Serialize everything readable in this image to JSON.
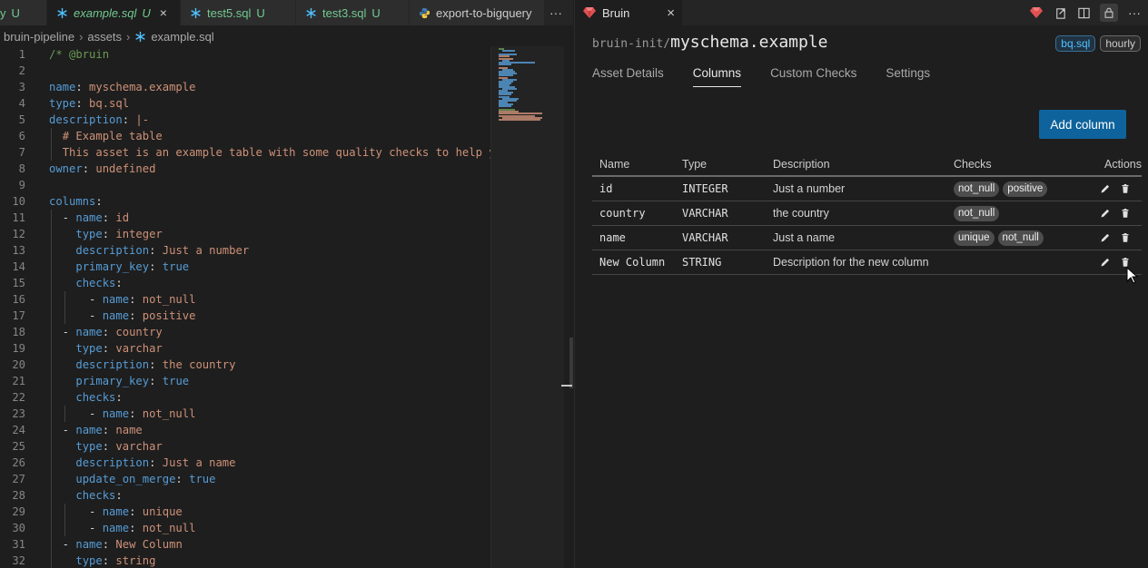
{
  "editor": {
    "tabs": [
      {
        "label": "y",
        "status": "U",
        "icon": "sql-icon"
      },
      {
        "label": "example.sql",
        "status": "U",
        "icon": "sql-icon",
        "active": true
      },
      {
        "label": "test5.sql",
        "status": "U",
        "icon": "sql-icon"
      },
      {
        "label": "test3.sql",
        "status": "U",
        "icon": "sql-icon"
      },
      {
        "label": "export-to-bigquery",
        "status": "",
        "icon": "python-icon"
      }
    ],
    "more": "···",
    "breadcrumb": [
      "bruin-pipeline",
      "assets",
      "example.sql"
    ],
    "line_numbers": [
      "1",
      "2",
      "3",
      "4",
      "5",
      "6",
      "7",
      "8",
      "9",
      "10",
      "11",
      "12",
      "13",
      "14",
      "15",
      "16",
      "17",
      "18",
      "19",
      "20",
      "21",
      "22",
      "23",
      "24",
      "25",
      "26",
      "27",
      "28",
      "29",
      "30",
      "31",
      "32"
    ],
    "code": {
      "l1": "/* @bruin",
      "l3k": "name",
      "l3v": "myschema.example",
      "l4k": "type",
      "l4v": "bq.sql",
      "l5k": "description",
      "l5v": "|-",
      "l6": "# Example table",
      "l7": "This asset is an example table with some quality checks to help yo",
      "l8k": "owner",
      "l8v": "undefined",
      "l10k": "columns",
      "l11k": "name",
      "l11v": "id",
      "l12k": "type",
      "l12v": "integer",
      "l13k": "description",
      "l13v": "Just a number",
      "l14k": "primary_key",
      "l14v": "true",
      "l15k": "checks",
      "l16k": "name",
      "l16v": "not_null",
      "l17k": "name",
      "l17v": "positive",
      "l18k": "name",
      "l18v": "country",
      "l19k": "type",
      "l19v": "varchar",
      "l20k": "description",
      "l20v": "the country",
      "l21k": "primary_key",
      "l21v": "true",
      "l22k": "checks",
      "l23k": "name",
      "l23v": "not_null",
      "l24k": "name",
      "l24v": "name",
      "l25k": "type",
      "l25v": "varchar",
      "l26k": "description",
      "l26v": "Just a name",
      "l27k": "update_on_merge",
      "l27v": "true",
      "l28k": "checks",
      "l29k": "name",
      "l29v": "unique",
      "l30k": "name",
      "l30v": "not_null",
      "l31k": "name",
      "l31v": "New Column",
      "l32k": "type",
      "l32v": "string"
    }
  },
  "panel": {
    "tab_label": "Bruin",
    "tab_close": "×",
    "asset_prefix": "bruin-init",
    "asset_slash": "/",
    "asset_name": "myschema.example",
    "badges": [
      "bq.sql",
      "hourly"
    ],
    "nav": [
      "Asset Details",
      "Columns",
      "Custom Checks",
      "Settings"
    ],
    "active_nav": "Columns",
    "add_column_label": "Add column",
    "table": {
      "headers": [
        "Name",
        "Type",
        "Description",
        "Checks",
        "Actions"
      ],
      "rows": [
        {
          "name": "id",
          "type": "INTEGER",
          "description": "Just a number",
          "checks": [
            "not_null",
            "positive"
          ]
        },
        {
          "name": "country",
          "type": "VARCHAR",
          "description": "the country",
          "checks": [
            "not_null"
          ]
        },
        {
          "name": "name",
          "type": "VARCHAR",
          "description": "Just a name",
          "checks": [
            "unique",
            "not_null"
          ]
        },
        {
          "name": "New Column",
          "type": "STRING",
          "description": "Description for the new column",
          "checks": []
        }
      ]
    }
  },
  "colors": {
    "accent": "#0e639c",
    "key": "#569cd6",
    "string": "#ce9178",
    "comment": "#6a9955",
    "untracked": "#73c991"
  }
}
